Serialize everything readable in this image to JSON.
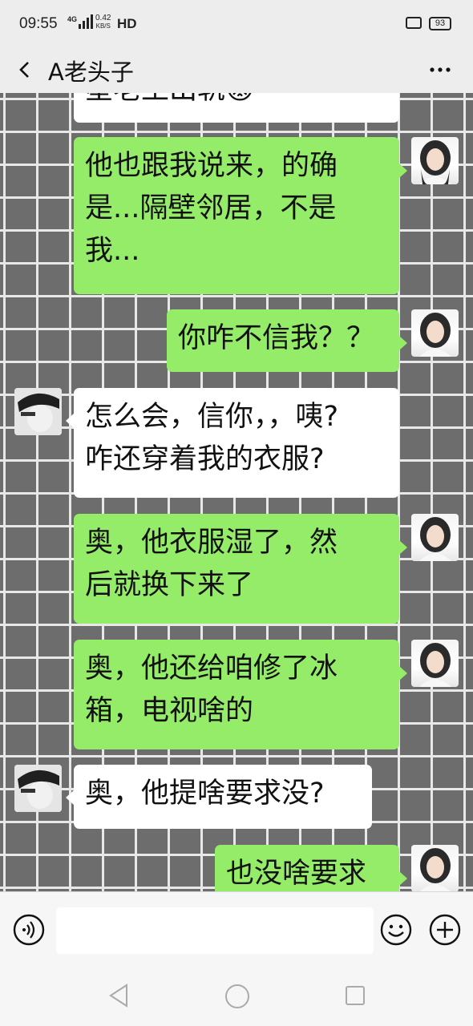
{
  "status_bar": {
    "time": "09:55",
    "network_type": "4G",
    "speed_value": "0.42",
    "speed_unit": "KB/S",
    "hd_label": "HD",
    "battery_level": "93"
  },
  "header": {
    "back_icon": "chevron-left-icon",
    "title": "A老头子",
    "more_icon": "more-dots-icon"
  },
  "chat": {
    "messages": [
      {
        "sender": "other",
        "text": "星老王出轨😡"
      },
      {
        "sender": "self",
        "line1": "他也跟我说来，的确",
        "line2": "是...隔壁邻居，不是",
        "line3": "我..."
      },
      {
        "sender": "self",
        "line1": "你咋不信我？？"
      },
      {
        "sender": "other",
        "line1": "怎么会，信你，，咦?",
        "line2": "咋还穿着我的衣服?"
      },
      {
        "sender": "self",
        "line1": "奥，他衣服湿了，然",
        "line2": "后就换下来了"
      },
      {
        "sender": "self",
        "line1": "奥，他还给咱修了冰",
        "line2": "箱，电视啥的"
      },
      {
        "sender": "other",
        "line1": "奥，他提啥要求没?"
      },
      {
        "sender": "self",
        "line1": "也没啥要求"
      }
    ]
  },
  "input_bar": {
    "voice_icon": "voice-icon",
    "text_value": "",
    "emoji_icon": "emoji-icon",
    "plus_icon": "plus-icon"
  },
  "nav_bar": {
    "back": "triangle-back-icon",
    "home": "circle-home-icon",
    "recent": "square-recent-icon"
  },
  "colors": {
    "self_bubble": "#95ec69",
    "other_bubble": "#ffffff",
    "chat_background_grid": "#6d6d6d"
  }
}
